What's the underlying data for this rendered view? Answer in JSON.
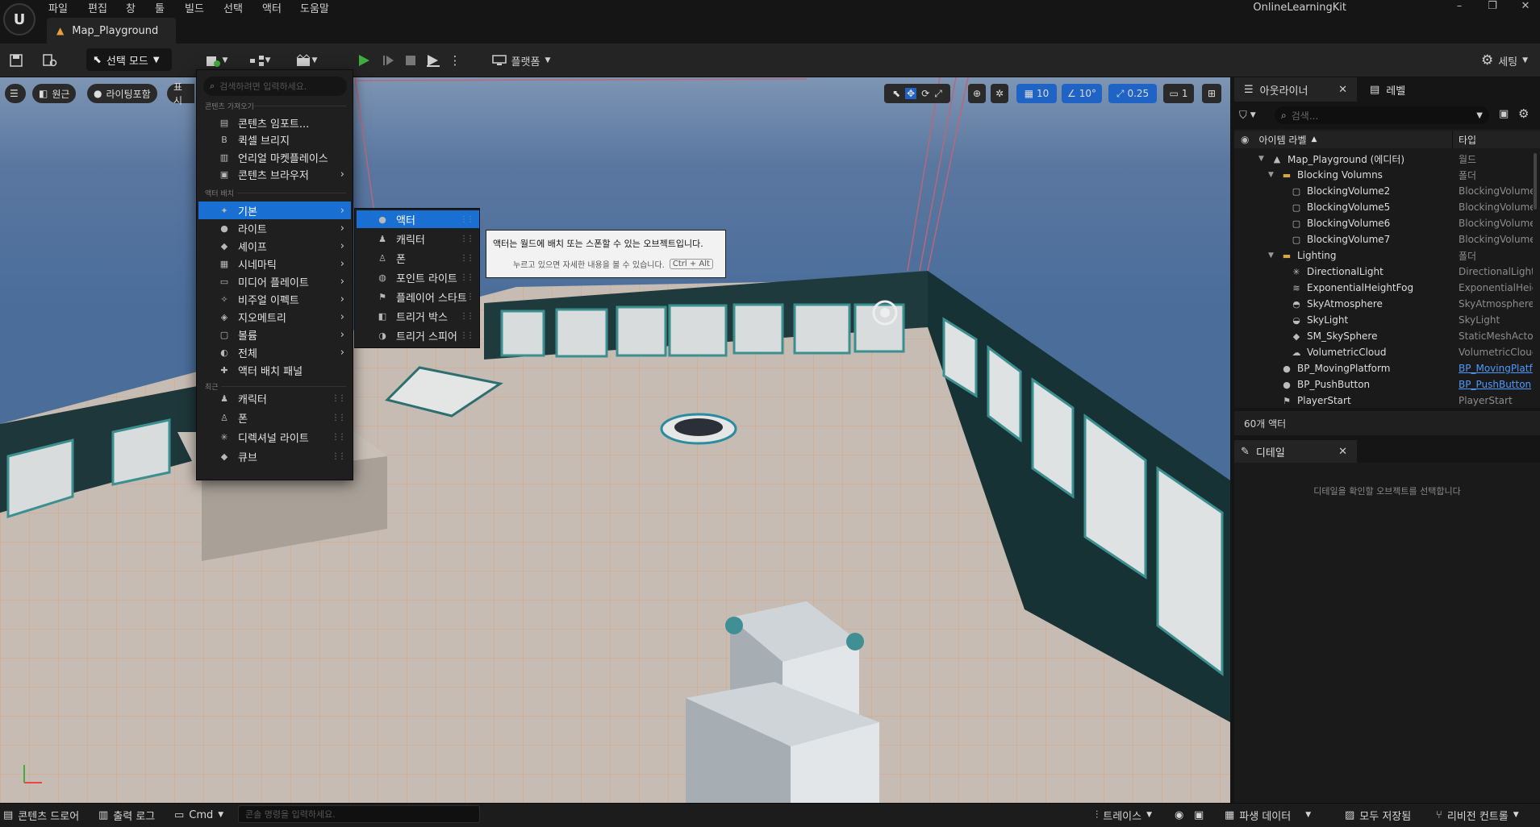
{
  "menubar": {
    "items": [
      "파일",
      "편집",
      "창",
      "툴",
      "빌드",
      "선택",
      "액터",
      "도움말"
    ]
  },
  "doc_tab": {
    "title": "Map_Playground"
  },
  "project_name": "OnlineLearningKit",
  "toolbar": {
    "mode": "선택 모드",
    "platform": "플랫폼",
    "settings": "세팅"
  },
  "viewport": {
    "perspective": "원근",
    "lighting": "라이팅포함",
    "show": "표시",
    "grid_snap": "10",
    "rotate_snap": "10°",
    "scale_snap": "0.25",
    "camera_speed": "1"
  },
  "add_menu": {
    "search_placeholder": "검색하려면 입력하세요.",
    "section_import": "콘텐츠 가져오기",
    "import_items": [
      {
        "label": "콘텐츠 임포트...",
        "icon": "import-icon"
      },
      {
        "label": "퀵셀 브리지",
        "icon": "bridge-icon"
      },
      {
        "label": "언리얼 마켓플레이스",
        "icon": "marketplace-icon"
      },
      {
        "label": "콘텐츠 브라우저",
        "icon": "content-browser-icon"
      }
    ],
    "section_place": "액터 배치",
    "place_items": [
      {
        "label": "기본",
        "icon": "basic-icon"
      },
      {
        "label": "라이트",
        "icon": "light-icon"
      },
      {
        "label": "셰이프",
        "icon": "shape-icon"
      },
      {
        "label": "시네마틱",
        "icon": "cinematic-icon"
      },
      {
        "label": "미디어 플레이트",
        "icon": "media-plate-icon"
      },
      {
        "label": "비주얼 이펙트",
        "icon": "visual-effects-icon"
      },
      {
        "label": "지오메트리",
        "icon": "geometry-icon"
      },
      {
        "label": "볼륨",
        "icon": "volume-icon"
      },
      {
        "label": "전체",
        "icon": "all-icon"
      },
      {
        "label": "액터 배치 패널",
        "icon": "place-panel-icon"
      }
    ],
    "section_recent": "최근",
    "recent_items": [
      {
        "label": "캐릭터",
        "icon": "character-icon"
      },
      {
        "label": "폰",
        "icon": "pawn-icon"
      },
      {
        "label": "디렉셔널 라이트",
        "icon": "directional-light-icon"
      },
      {
        "label": "큐브",
        "icon": "cube-icon"
      }
    ]
  },
  "sub_menu": {
    "items": [
      {
        "label": "액터",
        "icon": "actor-icon"
      },
      {
        "label": "캐릭터",
        "icon": "character-icon"
      },
      {
        "label": "폰",
        "icon": "pawn-icon"
      },
      {
        "label": "포인트 라이트",
        "icon": "point-light-icon"
      },
      {
        "label": "플레이어 스타트",
        "icon": "player-start-icon"
      },
      {
        "label": "트리거 박스",
        "icon": "trigger-box-icon"
      },
      {
        "label": "트리거 스피어",
        "icon": "trigger-sphere-icon"
      }
    ]
  },
  "tooltip": {
    "text": "액터는 월드에 배치 또는 스폰할 수 있는 오브젝트입니다.",
    "hint": "누르고 있으면 자세한 내용을 볼 수 있습니다.",
    "shortcut": "Ctrl + Alt"
  },
  "outliner": {
    "tab": "아웃라이너",
    "level_tab": "레벨",
    "search_placeholder": "검색...",
    "col_label": "아이템 라벨",
    "col_type": "타입",
    "rows": [
      {
        "name": "Map_Playground (에디터)",
        "type": "월드",
        "indent": 0,
        "icon": "world-icon",
        "caret": "▼"
      },
      {
        "name": "Blocking Volumns",
        "type": "폴더",
        "indent": 1,
        "icon": "folder-icon",
        "caret": "▼"
      },
      {
        "name": "BlockingVolume2",
        "type": "BlockingVolume",
        "indent": 2,
        "icon": "volume-icon"
      },
      {
        "name": "BlockingVolume5",
        "type": "BlockingVolume",
        "indent": 2,
        "icon": "volume-icon"
      },
      {
        "name": "BlockingVolume6",
        "type": "BlockingVolume",
        "indent": 2,
        "icon": "volume-icon"
      },
      {
        "name": "BlockingVolume7",
        "type": "BlockingVolume",
        "indent": 2,
        "icon": "volume-icon"
      },
      {
        "name": "Lighting",
        "type": "폴더",
        "indent": 1,
        "icon": "folder-icon",
        "caret": "▼"
      },
      {
        "name": "DirectionalLight",
        "type": "DirectionalLight",
        "indent": 2,
        "icon": "directional-light-icon"
      },
      {
        "name": "ExponentialHeightFog",
        "type": "ExponentialHeig",
        "indent": 2,
        "icon": "fog-icon"
      },
      {
        "name": "SkyAtmosphere",
        "type": "SkyAtmosphere",
        "indent": 2,
        "icon": "sky-atmosphere-icon"
      },
      {
        "name": "SkyLight",
        "type": "SkyLight",
        "indent": 2,
        "icon": "skylight-icon"
      },
      {
        "name": "SM_SkySphere",
        "type": "StaticMeshActo",
        "indent": 2,
        "icon": "static-mesh-icon"
      },
      {
        "name": "VolumetricCloud",
        "type": "VolumetricClouc",
        "indent": 2,
        "icon": "cloud-icon"
      },
      {
        "name": "BP_MovingPlatform",
        "type": "BP_MovingPlatf",
        "indent": 1,
        "icon": "blueprint-icon",
        "link": true
      },
      {
        "name": "BP_PushButton",
        "type": "BP_PushButton",
        "indent": 1,
        "icon": "blueprint-icon",
        "link": true
      },
      {
        "name": "PlayerStart",
        "type": "PlayerStart",
        "indent": 1,
        "icon": "player-start-icon"
      }
    ],
    "actor_count": "60개 액터"
  },
  "details": {
    "tab": "디테일",
    "empty_text": "디테일을 확인할 오브젝트를 선택합니다"
  },
  "statusbar": {
    "content_drawer": "콘텐츠 드로어",
    "output_log": "출력 로그",
    "cmd": "Cmd",
    "console_placeholder": "콘솔 명령을 입력하세요.",
    "trace": "트레이스",
    "derived_data": "파생 데이터",
    "save_all": "모두 저장됨",
    "revision_control": "리비전 컨트롤"
  },
  "colors": {
    "accent": "#1a6fd3",
    "warning": "#e8a13a",
    "link": "#4c9aff",
    "play": "#3fae3f"
  }
}
